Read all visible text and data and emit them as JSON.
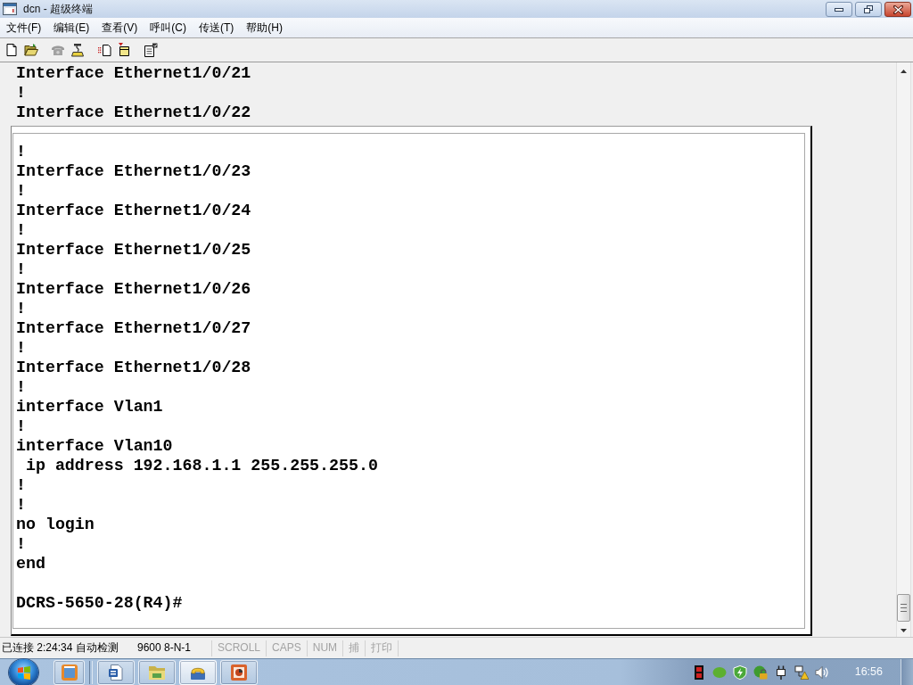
{
  "window": {
    "title": "dcn - 超级终端"
  },
  "menu": [
    "文件(F)",
    "编辑(E)",
    "查看(V)",
    "呼叫(C)",
    "传送(T)",
    "帮助(H)"
  ],
  "toolbar": {
    "groups": [
      [
        {
          "kind": "new",
          "disabled": false
        },
        {
          "kind": "open",
          "disabled": false
        }
      ],
      [
        {
          "kind": "call",
          "disabled": true
        },
        {
          "kind": "disconnect",
          "disabled": false
        }
      ],
      [
        {
          "kind": "send",
          "disabled": false
        },
        {
          "kind": "receive",
          "disabled": false
        }
      ],
      [
        {
          "kind": "properties",
          "disabled": false
        }
      ]
    ]
  },
  "terminal": {
    "lines": [
      "Interface Ethernet1/0/21",
      "!",
      "Interface Ethernet1/0/22"
    ],
    "panel": {
      "lines": [
        "!",
        "Interface Ethernet1/0/23",
        "!",
        "Interface Ethernet1/0/24",
        "!",
        "Interface Ethernet1/0/25",
        "!",
        "Interface Ethernet1/0/26",
        "!",
        "Interface Ethernet1/0/27",
        "!",
        "Interface Ethernet1/0/28",
        "!",
        "interface Vlan1",
        "!",
        "interface Vlan10",
        " ip address 192.168.1.1 255.255.255.0",
        "!",
        "!",
        "no login",
        "!",
        "end"
      ],
      "prompt": "DCRS-5650-28(R4)#"
    }
  },
  "status_bar": {
    "connection": "已连接 2:24:34 自动检测",
    "port_settings": "9600 8-N-1",
    "indicators": [
      {
        "label": "SCROLL",
        "on": false
      },
      {
        "label": "CAPS",
        "on": false
      },
      {
        "label": "NUM",
        "on": false
      },
      {
        "label": "捕",
        "on": false
      },
      {
        "label": "打印",
        "on": false
      }
    ]
  },
  "taskbar": {
    "buttons": [
      {
        "kind": "window",
        "selected": false
      },
      {
        "kind": "document",
        "selected": false
      },
      {
        "kind": "folder",
        "selected": false
      },
      {
        "kind": "terminal",
        "selected": true
      },
      {
        "kind": "presentation",
        "selected": false
      }
    ],
    "clock": "16:56"
  }
}
